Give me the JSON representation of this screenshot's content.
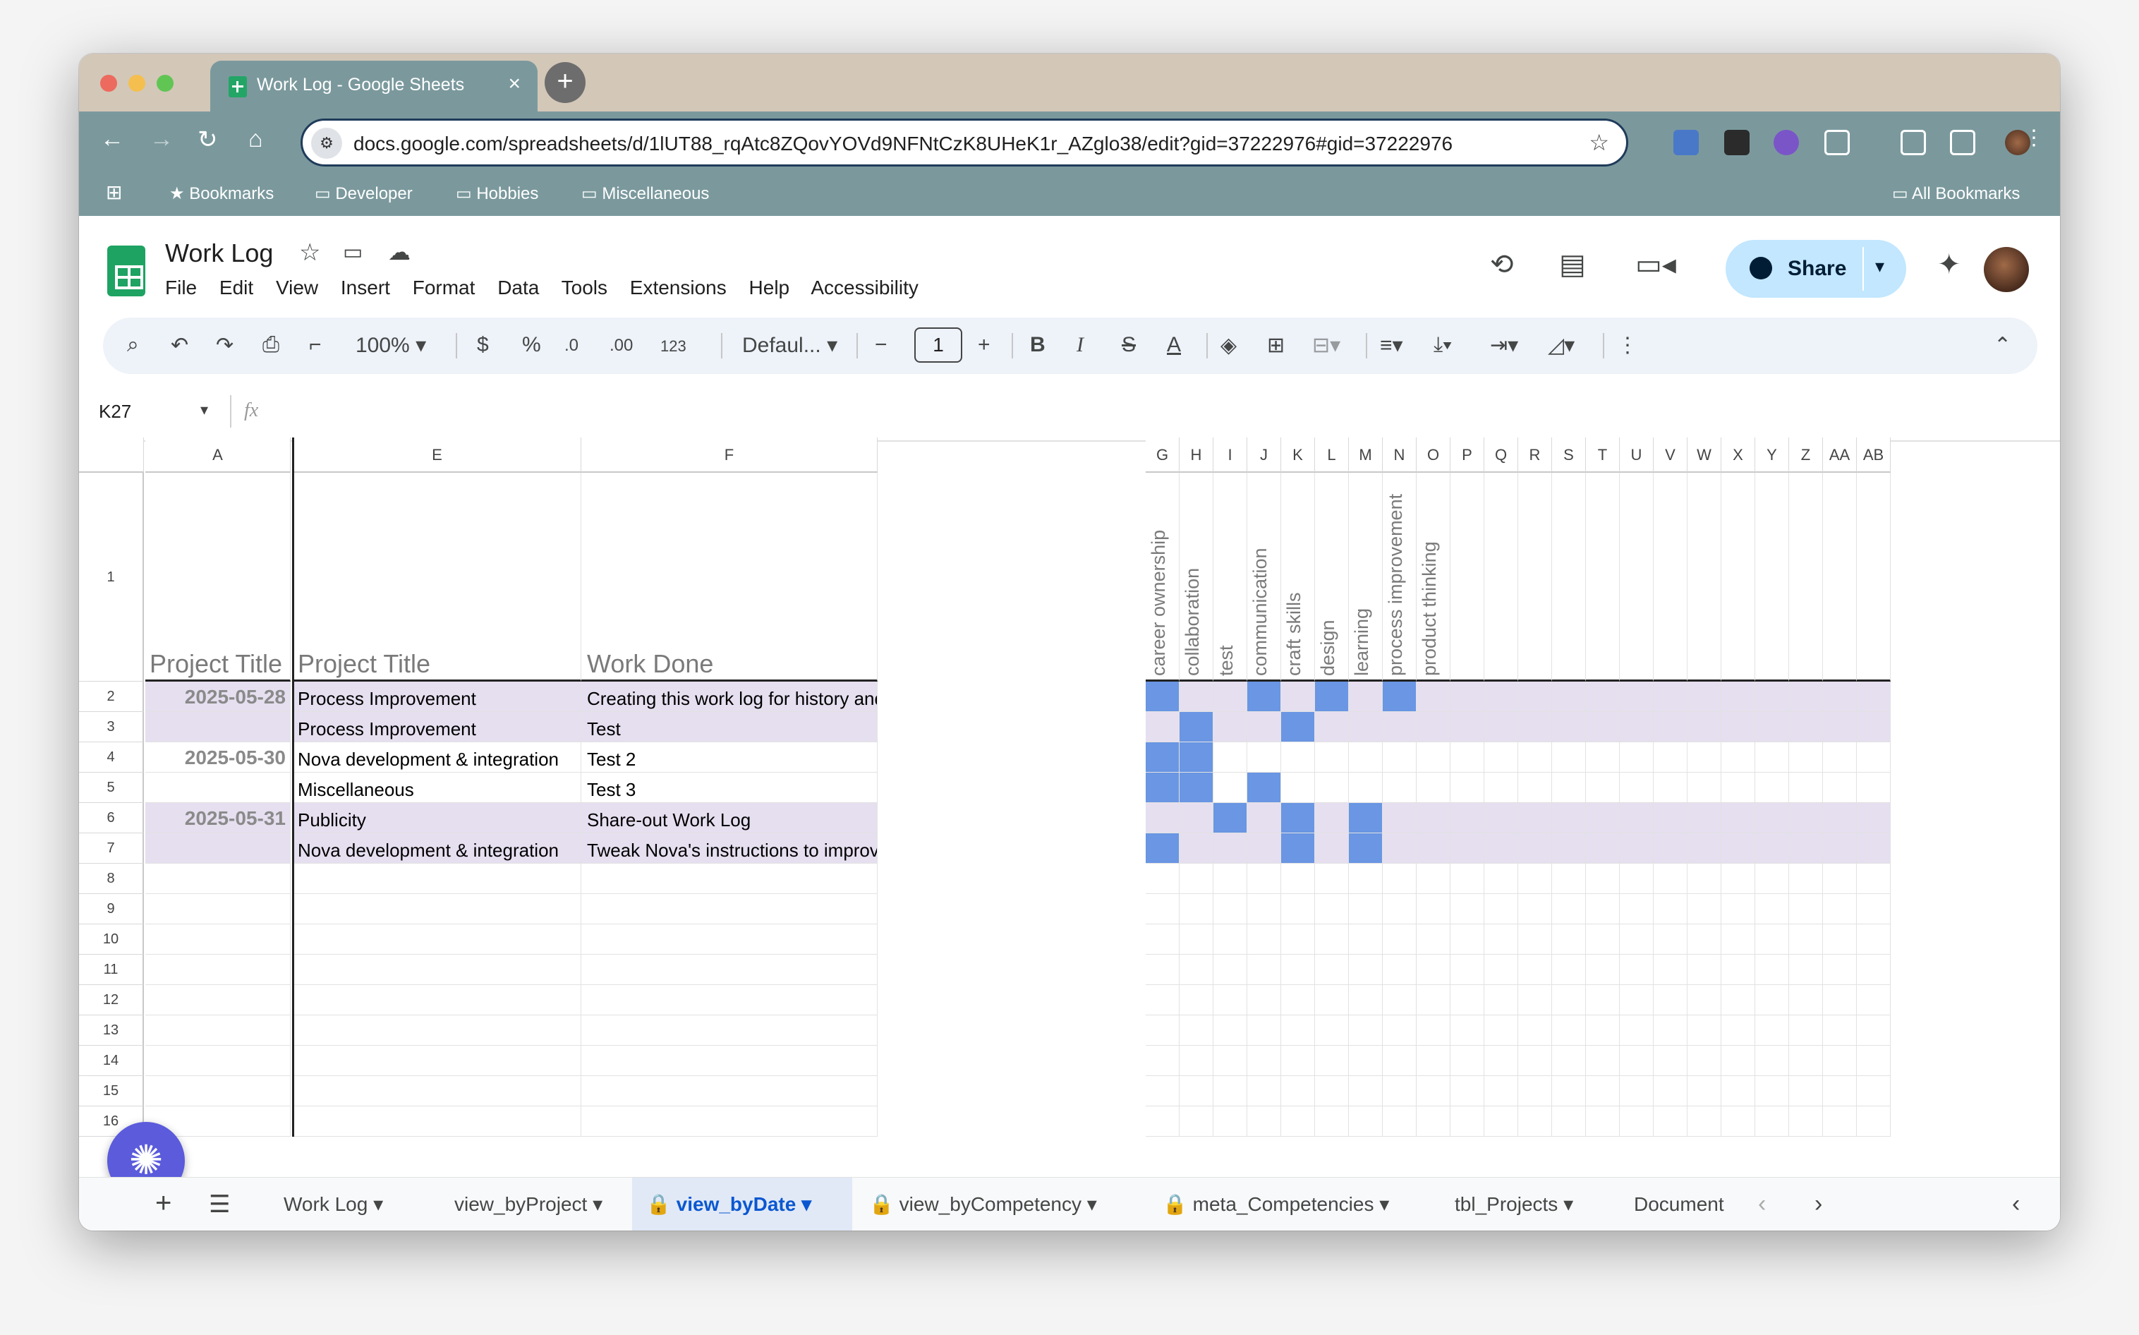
{
  "browser": {
    "tab_title": "Work Log - Google Sheets",
    "tab_close": "×",
    "new_tab": "+",
    "url": "docs.google.com/spreadsheets/d/1lUT88_rqAtc8ZQovYOVd9NFNtCzK8UHeK1r_AZglo38/edit?gid=37222976#gid=37222976",
    "bookmarks": [
      "Bookmarks",
      "Developer",
      "Hobbies",
      "Miscellaneous"
    ],
    "all_bookmarks": "All Bookmarks"
  },
  "sheets": {
    "title": "Work Log",
    "menu": [
      "File",
      "Edit",
      "View",
      "Insert",
      "Format",
      "Data",
      "Tools",
      "Extensions",
      "Help",
      "Accessibility"
    ],
    "share_label": "Share",
    "zoom": "100%",
    "currency": "$",
    "percent": "%",
    "dec_dec": ".0",
    "dec_inc": ".00",
    "number_format": "123",
    "font": "Defaul...",
    "font_size": "1",
    "bold": "B",
    "italic": "I",
    "strike": "S",
    "textcolor": "A",
    "namebox": "K27",
    "fx": "fx"
  },
  "grid": {
    "columns": [
      "A",
      "E",
      "F",
      "G",
      "H",
      "I",
      "J",
      "K",
      "L",
      "M",
      "N",
      "O",
      "P",
      "Q",
      "R",
      "S",
      "T",
      "U",
      "V",
      "W",
      "X",
      "Y",
      "Z",
      "AA",
      "AB"
    ],
    "header_row": {
      "a": "Project Title",
      "e": "Project Title",
      "f": "Work Done",
      "competencies": [
        "career ownership",
        "collaboration",
        "test",
        "communication",
        "craft skills",
        "design",
        "learning",
        "process improvement",
        "product thinking"
      ]
    },
    "rows": [
      {
        "num": "2",
        "date": "2025-05-28",
        "project": "Process Improvement",
        "work": "Creating this work log for history and visibility of efforts and impacts",
        "marks": [
          1,
          0,
          0,
          1,
          0,
          1,
          0,
          1,
          0
        ]
      },
      {
        "num": "3",
        "date": "",
        "project": "Process Improvement",
        "work": "Test",
        "marks": [
          0,
          1,
          0,
          0,
          1,
          0,
          0,
          0,
          0
        ]
      },
      {
        "num": "4",
        "date": "2025-05-30",
        "project": "Nova development & integration",
        "work": "Test 2",
        "marks": [
          1,
          1,
          0,
          0,
          0,
          0,
          0,
          0,
          0
        ]
      },
      {
        "num": "5",
        "date": "",
        "project": "Miscellaneous",
        "work": "Test 3",
        "marks": [
          1,
          1,
          0,
          1,
          0,
          0,
          0,
          0,
          0
        ]
      },
      {
        "num": "6",
        "date": "2025-05-31",
        "project": "Publicity",
        "work": "Share-out Work Log",
        "marks": [
          0,
          0,
          1,
          0,
          1,
          0,
          1,
          0,
          0
        ]
      },
      {
        "num": "7",
        "date": "",
        "project": "Nova development & integration",
        "work": "Tweak Nova's instructions to improve data fetch from Jira",
        "marks": [
          1,
          0,
          0,
          0,
          1,
          0,
          1,
          0,
          0
        ]
      }
    ],
    "empty_rows": [
      "8",
      "9",
      "10",
      "11",
      "12",
      "13",
      "14",
      "15",
      "16"
    ],
    "row1_num": "1"
  },
  "sheet_tabs": [
    {
      "label": "Work Log",
      "locked": false,
      "active": false
    },
    {
      "label": "view_byProject",
      "locked": false,
      "active": false
    },
    {
      "label": "view_byDate",
      "locked": true,
      "active": true
    },
    {
      "label": "view_byCompetency",
      "locked": true,
      "active": false
    },
    {
      "label": "meta_Competencies",
      "locked": true,
      "active": false
    },
    {
      "label": "tbl_Projects",
      "locked": false,
      "active": false
    },
    {
      "label": "Document",
      "locked": false,
      "active": false
    }
  ],
  "colors": {
    "row_tint": "#e6dff0",
    "mark_blue": "#6a96e3",
    "accent": "#0b57d0"
  }
}
